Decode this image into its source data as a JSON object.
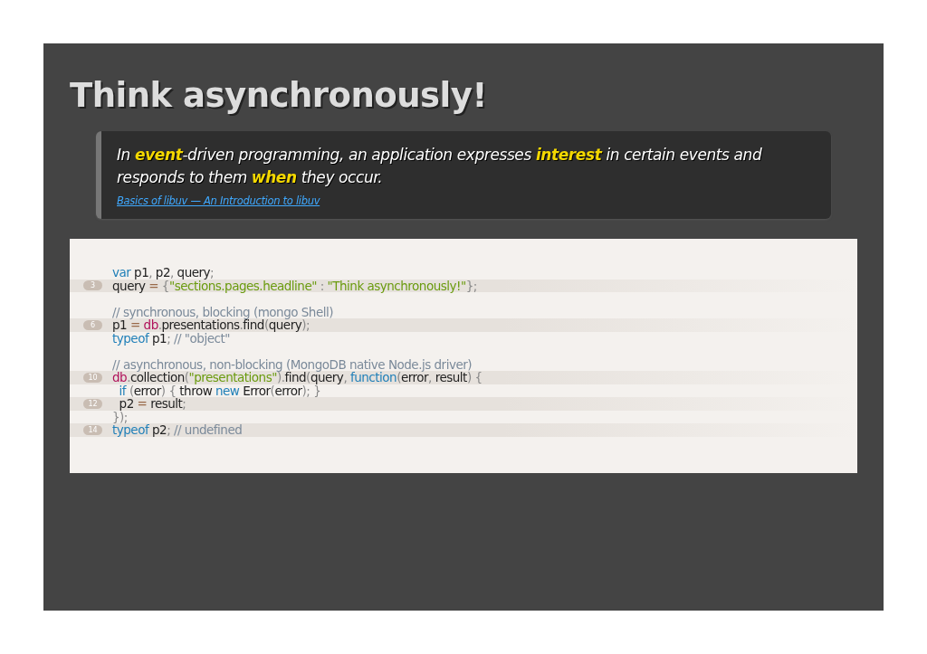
{
  "slide": {
    "title": "Think asynchronously!",
    "quote": {
      "text": "In **event**-driven programming, an application expresses **interest** in certain events and responds to them **when** they occur.",
      "source_link": "Basics of libuv — An Introduction to libuv"
    },
    "code": {
      "lines": [
        {
          "highlighted": false,
          "tokens": [
            {
              "kind": "keyword",
              "text": "var"
            },
            {
              "kind": "plain",
              "text": " p1"
            },
            {
              "kind": "punct",
              "text": ","
            },
            {
              "kind": "plain",
              "text": " p2"
            },
            {
              "kind": "punct",
              "text": ","
            },
            {
              "kind": "plain",
              "text": " query"
            },
            {
              "kind": "punct",
              "text": ";"
            }
          ]
        },
        {
          "highlighted": true,
          "number": "3",
          "tokens": [
            {
              "kind": "plain",
              "text": "query "
            },
            {
              "kind": "operator",
              "text": "="
            },
            {
              "kind": "punct",
              "text": " {"
            },
            {
              "kind": "string",
              "text": "\"sections.pages.headline\""
            },
            {
              "kind": "punct",
              "text": " : "
            },
            {
              "kind": "string",
              "text": "\"Think asynchronously!\""
            },
            {
              "kind": "punct",
              "text": "};"
            }
          ]
        },
        {
          "highlighted": false
        },
        {
          "highlighted": false,
          "tokens": [
            {
              "kind": "comment",
              "text": "// synchronous, blocking (mongo Shell)"
            }
          ]
        },
        {
          "highlighted": true,
          "number": "6",
          "tokens": [
            {
              "kind": "plain",
              "text": "p1 "
            },
            {
              "kind": "operator",
              "text": "="
            },
            {
              "kind": "object",
              "text": " db"
            },
            {
              "kind": "punct",
              "text": "."
            },
            {
              "kind": "plain",
              "text": "presentations"
            },
            {
              "kind": "punct",
              "text": "."
            },
            {
              "kind": "plain",
              "text": "find"
            },
            {
              "kind": "punct",
              "text": "("
            },
            {
              "kind": "plain",
              "text": "query"
            },
            {
              "kind": "punct",
              "text": ");"
            }
          ]
        },
        {
          "highlighted": false,
          "tokens": [
            {
              "kind": "keyword",
              "text": "typeof"
            },
            {
              "kind": "plain",
              "text": " p1"
            },
            {
              "kind": "punct",
              "text": ";"
            },
            {
              "kind": "comment",
              "text": " // \"object\""
            }
          ]
        },
        {
          "highlighted": false
        },
        {
          "highlighted": false,
          "tokens": [
            {
              "kind": "comment",
              "text": "// asynchronous, non-blocking (MongoDB native Node.js driver)"
            }
          ]
        },
        {
          "highlighted": true,
          "number": "10",
          "tokens": [
            {
              "kind": "object",
              "text": "db"
            },
            {
              "kind": "punct",
              "text": "."
            },
            {
              "kind": "plain",
              "text": "collection"
            },
            {
              "kind": "punct",
              "text": "("
            },
            {
              "kind": "string",
              "text": "\"presentations\""
            },
            {
              "kind": "punct",
              "text": ")."
            },
            {
              "kind": "plain",
              "text": "find"
            },
            {
              "kind": "punct",
              "text": "("
            },
            {
              "kind": "plain",
              "text": "query"
            },
            {
              "kind": "punct",
              "text": ", "
            },
            {
              "kind": "keyword",
              "text": "function"
            },
            {
              "kind": "punct",
              "text": "("
            },
            {
              "kind": "plain",
              "text": "error"
            },
            {
              "kind": "punct",
              "text": ", "
            },
            {
              "kind": "plain",
              "text": "result"
            },
            {
              "kind": "punct",
              "text": ") {"
            }
          ]
        },
        {
          "highlighted": false,
          "tokens": [
            {
              "kind": "keyword",
              "text": "  if"
            },
            {
              "kind": "punct",
              "text": " ("
            },
            {
              "kind": "plain",
              "text": "error"
            },
            {
              "kind": "punct",
              "text": ") { "
            },
            {
              "kind": "plain",
              "text": "throw "
            },
            {
              "kind": "keyword",
              "text": "new"
            },
            {
              "kind": "plain",
              "text": " Error"
            },
            {
              "kind": "punct",
              "text": "("
            },
            {
              "kind": "plain",
              "text": "error"
            },
            {
              "kind": "punct",
              "text": "); }"
            }
          ]
        },
        {
          "highlighted": true,
          "number": "12",
          "tokens": [
            {
              "kind": "plain",
              "text": "  p2 "
            },
            {
              "kind": "operator",
              "text": "="
            },
            {
              "kind": "plain",
              "text": " result"
            },
            {
              "kind": "punct",
              "text": ";"
            }
          ]
        },
        {
          "highlighted": false,
          "tokens": [
            {
              "kind": "punct",
              "text": "});"
            }
          ]
        },
        {
          "highlighted": true,
          "number": "14",
          "tokens": [
            {
              "kind": "keyword",
              "text": "typeof"
            },
            {
              "kind": "plain",
              "text": " p2"
            },
            {
              "kind": "punct",
              "text": ";"
            },
            {
              "kind": "comment",
              "text": " // undefined"
            }
          ]
        }
      ]
    }
  }
}
